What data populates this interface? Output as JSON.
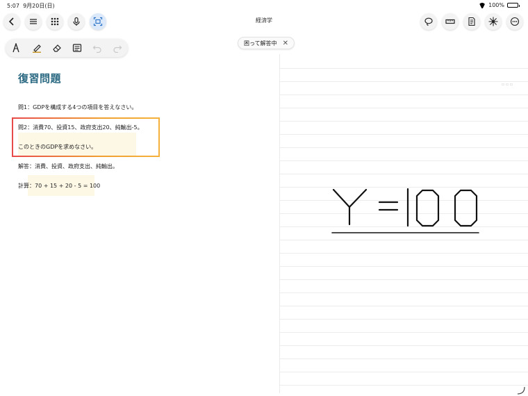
{
  "status_bar": {
    "time": "5:07",
    "date": "9月20日(日)",
    "battery": "100%"
  },
  "toolbar": {
    "title": "経済学",
    "left_icons": [
      "back-icon",
      "menu-icon",
      "grid-icon",
      "microphone-icon",
      "screen-capture-icon"
    ],
    "right_icons": [
      "lasso-icon",
      "ruler-icon",
      "page-icon",
      "sparkle-icon",
      "more-icon"
    ]
  },
  "tools": [
    "pen-icon",
    "highlighter-icon",
    "eraser-icon",
    "text-box-icon",
    "undo-icon",
    "redo-icon"
  ],
  "status_pill": {
    "label": "困って解答中",
    "close": "✕"
  },
  "note": {
    "heading": "復習問題",
    "q1": "問1：GDPを構成する4つの項目を答えなさい。",
    "q2_line1": "問2：消費70、投資15、政府支出20、純輸出-5。",
    "q2_line2": "このときのGDPを求めなさい。",
    "answer": "解答：消費、投資、政府支出、純輸出。",
    "calc": "計算：70 + 15 + 20 - 5 = 100"
  },
  "handwriting": "Y =100",
  "colors": {
    "heading": "#2c6a83",
    "focus_gradient_start": "#e84a4a",
    "focus_gradient_end": "#f5b13c",
    "highlight": "#fdf7e6"
  }
}
